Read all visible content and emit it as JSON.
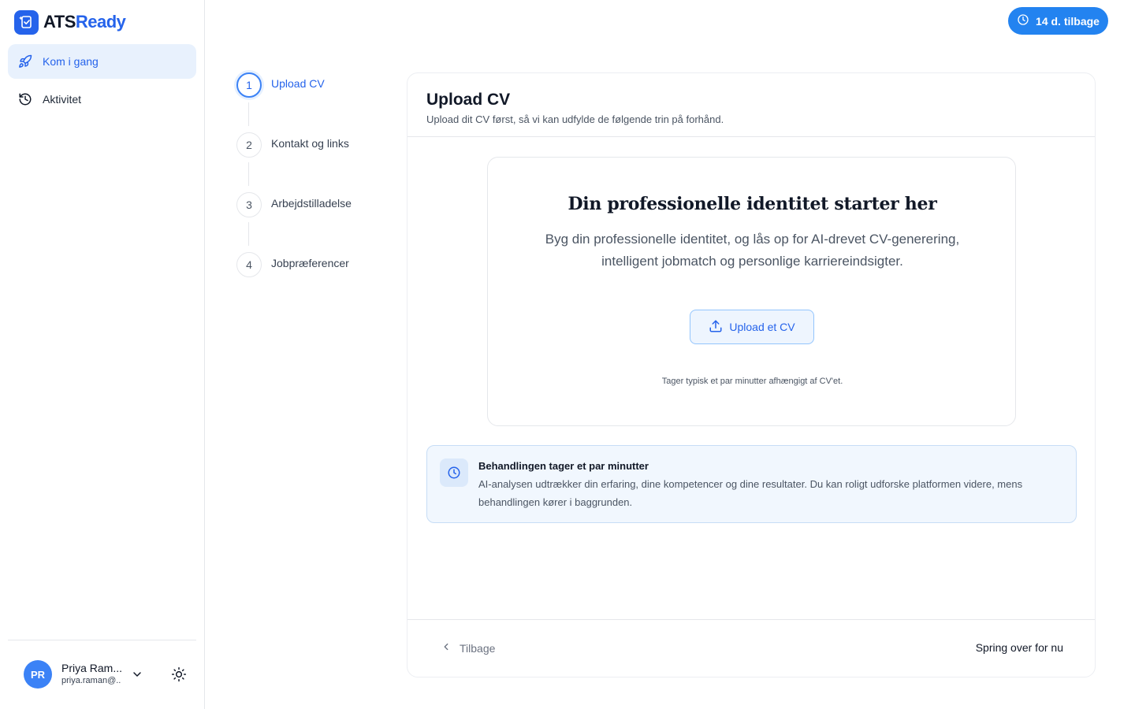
{
  "brand": {
    "name_part1": "ATS",
    "name_part2": "Ready",
    "accent": "#2563eb"
  },
  "sidebar": {
    "items": [
      {
        "label": "Kom i gang",
        "icon": "rocket-icon",
        "active": true
      },
      {
        "label": "Aktivitet",
        "icon": "history-icon",
        "active": false
      }
    ]
  },
  "user": {
    "initials": "PR",
    "name": "Priya Ram...",
    "email": "priya.raman@..."
  },
  "trial": {
    "label": "14 d. tilbage"
  },
  "steps": [
    {
      "number": "1",
      "label": "Upload CV",
      "active": true
    },
    {
      "number": "2",
      "label": "Kontakt og links",
      "active": false
    },
    {
      "number": "3",
      "label": "Arbejdstilladelse",
      "active": false
    },
    {
      "number": "4",
      "label": "Jobpræferencer",
      "active": false
    }
  ],
  "card": {
    "title": "Upload CV",
    "subtitle": "Upload dit CV først, så vi kan udfylde de følgende trin på forhånd."
  },
  "upload": {
    "heading": "Din professionelle identitet starter her",
    "description": "Byg din professionelle identitet, og lås op for AI-drevet CV-generering, intelligent jobmatch og personlige karriereindsigter.",
    "button_label": "Upload et CV",
    "note": "Tager typisk et par minutter afhængigt af CV'et."
  },
  "info": {
    "title": "Behandlingen tager et par minutter",
    "text": "AI-analysen udtrækker din erfaring, dine kompetencer og dine resultater. Du kan roligt udforske platformen videre, mens behandlingen kører i baggrunden."
  },
  "footer": {
    "back_label": "Tilbage",
    "skip_label": "Spring over for nu"
  }
}
